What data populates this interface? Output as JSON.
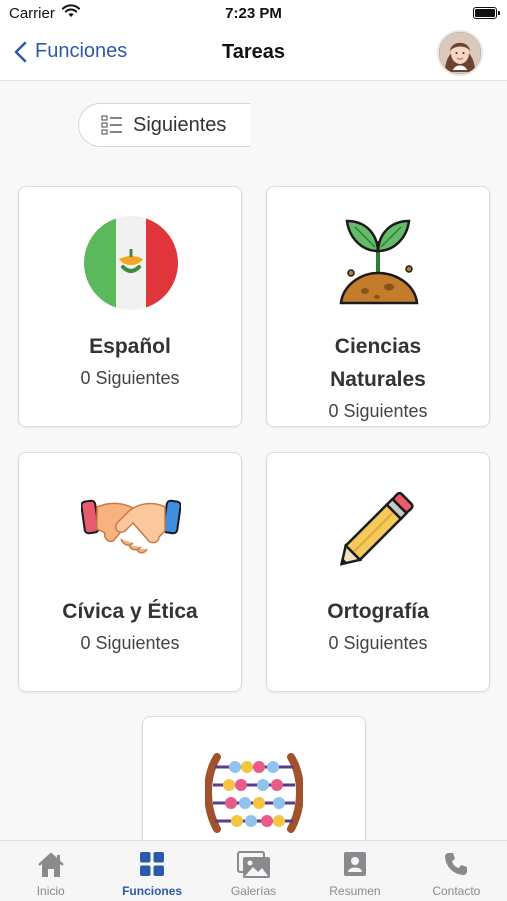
{
  "status_bar": {
    "carrier": "Carrier",
    "time": "7:23 PM"
  },
  "nav": {
    "back_label": "Funciones",
    "title": "Tareas"
  },
  "filter": {
    "label": "Siguientes"
  },
  "subjects": [
    {
      "title": "Español",
      "count": "0 Siguientes",
      "icon": "mexico-flag-icon"
    },
    {
      "title_line1": "Ciencias",
      "title_line2": "Naturales",
      "count": "0 Siguientes",
      "icon": "plant-sprout-icon"
    },
    {
      "title": "Cívica y Ética",
      "count": "0 Siguientes",
      "icon": "handshake-icon"
    },
    {
      "title": "Ortografía",
      "count": "0 Siguientes",
      "icon": "pencil-icon"
    },
    {
      "icon": "abacus-icon"
    }
  ],
  "tabs": [
    {
      "label": "Inicio",
      "icon": "home-icon"
    },
    {
      "label": "Funciones",
      "icon": "grid-icon",
      "active": true
    },
    {
      "label": "Galerías",
      "icon": "gallery-icon"
    },
    {
      "label": "Resumen",
      "icon": "profile-card-icon"
    },
    {
      "label": "Contacto",
      "icon": "phone-icon"
    }
  ],
  "colors": {
    "accent": "#2d5aa8",
    "inactive": "#8a8a8e"
  }
}
